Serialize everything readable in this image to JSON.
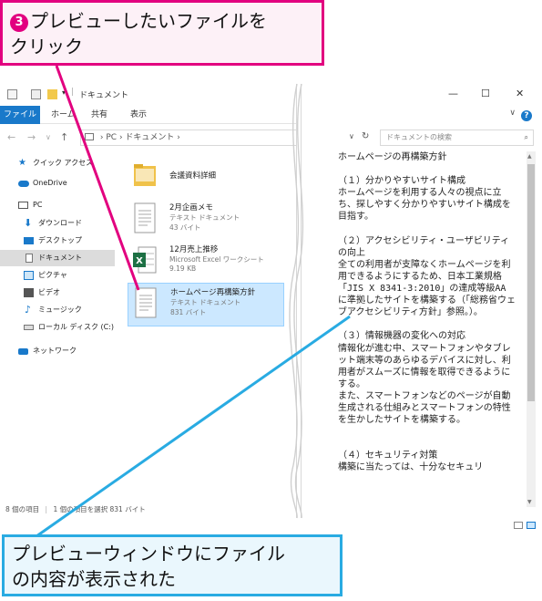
{
  "callouts": {
    "top_step": "3",
    "top_text": "プレビューしたいファイルを\nクリック",
    "bottom_text": "プレビューウィンドウにファイル\nの内容が表示された"
  },
  "window": {
    "title": "ドキュメント",
    "tabs": [
      "ファイル",
      "ホーム",
      "共有",
      "表示"
    ],
    "breadcrumb": [
      "PC",
      "ドキュメント"
    ],
    "search_placeholder": "ドキュメントの検索",
    "controls": {
      "minimize": "—",
      "maximize": "☐",
      "close": "✕"
    }
  },
  "sidebar": {
    "items": [
      {
        "label": "クイック アクセス",
        "icon": "star-icon"
      },
      {
        "label": "OneDrive",
        "icon": "cloud-icon"
      },
      {
        "label": "PC",
        "icon": "computer-icon"
      },
      {
        "label": "ダウンロード",
        "icon": "download-icon"
      },
      {
        "label": "デスクトップ",
        "icon": "desktop-icon"
      },
      {
        "label": "ドキュメント",
        "icon": "document-icon"
      },
      {
        "label": "ピクチャ",
        "icon": "pictures-icon"
      },
      {
        "label": "ビデオ",
        "icon": "video-icon"
      },
      {
        "label": "ミュージック",
        "icon": "music-icon"
      },
      {
        "label": "ローカル ディスク (C:)",
        "icon": "disk-icon"
      },
      {
        "label": "ネットワーク",
        "icon": "network-icon"
      }
    ]
  },
  "files": [
    {
      "name": "会議資料詳細",
      "type": "",
      "size": "",
      "icon": "folder-icon"
    },
    {
      "name": "2月企画メモ",
      "type": "テキスト ドキュメント",
      "size": "43 バイト",
      "icon": "text-file-icon"
    },
    {
      "name": "12月売上推移",
      "type": "Microsoft Excel ワークシート",
      "size": "9.19 KB",
      "icon": "excel-icon"
    },
    {
      "name": "ホームページ再構築方針",
      "type": "テキスト ドキュメント",
      "size": "831 バイト",
      "icon": "text-file-icon"
    }
  ],
  "status": {
    "count": "8 個の項目",
    "selection": "1 個の項目を選択 831 バイト"
  },
  "preview": {
    "text": "ホームページの再構築方針\n\n（１）分かりやすいサイト構成\nホームページを利用する人々の視点に立ち、探しやすく分かりやすいサイト構成を目指す。\n\n（２）アクセシビリティ・ユーザビリティの向上\n全ての利用者が支障なくホームページを利用できるようにするため、日本工業規格「JIS X 8341-3:2010」の達成等級AA に準拠したサイトを構築する（「総務省ウェブアクセシビリティ方針」参照。）。\n\n（３）情報機器の変化への対応\n情報化が進む中、スマートフォンやタブレット端末等のあらゆるデバイスに対し、利用者がスムーズに情報を取得できるようにする。\nまた、スマートフォンなどのページが自動生成される仕組みとスマートフォンの特性を生かしたサイトを構築する。\n\n\n（４）セキュリティ対策\n構築に当たっては、十分なセキュリ"
  },
  "colors": {
    "accent_pink": "#e2007f",
    "accent_blue": "#29abe2",
    "ribbon_blue": "#1979ca",
    "selection_blue": "#cce8ff"
  }
}
